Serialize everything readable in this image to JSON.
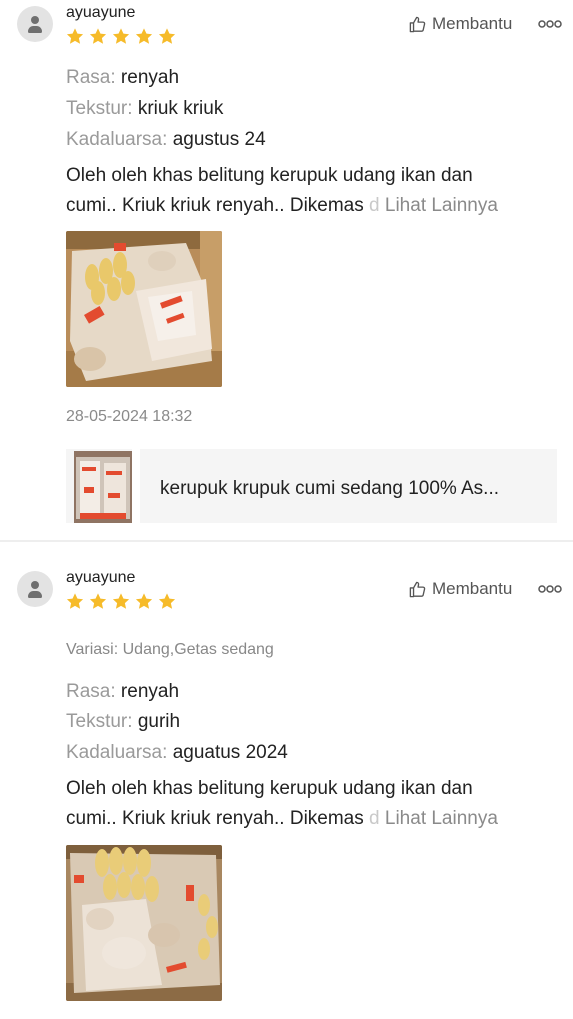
{
  "reviews": [
    {
      "username": "ayuayune",
      "rating": 5,
      "helpful_label": "Membantu",
      "attributes": [
        {
          "key": "Rasa: ",
          "value": "renyah"
        },
        {
          "key": "Tekstur: ",
          "value": "kriuk kriuk"
        },
        {
          "key": "Kadaluarsa: ",
          "value": "agustus 24"
        }
      ],
      "text_line1": "Oleh oleh khas belitung kerupuk udang ikan dan",
      "text_line2": "cumi.. Kriuk kriuk renyah.. Dikemas",
      "text_fade": " d",
      "see_more": "Lihat Lainnya",
      "timestamp": "28-05-2024 18:32",
      "product_name": "kerupuk krupuk cumi sedang 100% As..."
    },
    {
      "username": "ayuayune",
      "rating": 5,
      "helpful_label": "Membantu",
      "variant": "Variasi: Udang,Getas sedang",
      "attributes": [
        {
          "key": "Rasa: ",
          "value": "renyah"
        },
        {
          "key": "Tekstur: ",
          "value": "gurih"
        },
        {
          "key": "Kadaluarsa: ",
          "value": "aguatus 2024"
        }
      ],
      "text_line1": "Oleh oleh khas belitung kerupuk udang ikan dan",
      "text_line2": "cumi.. Kriuk kriuk renyah.. Dikemas",
      "text_fade": " d",
      "see_more": "Lihat Lainnya"
    }
  ],
  "icons": {
    "avatar": "user-avatar-icon",
    "star": "star-icon",
    "helpful": "thumbs-up-icon",
    "more": "more-options-icon"
  },
  "colors": {
    "star": "#f6bb2a",
    "muted_text": "#9a9a9a",
    "card_bg": "#f5f5f5"
  }
}
